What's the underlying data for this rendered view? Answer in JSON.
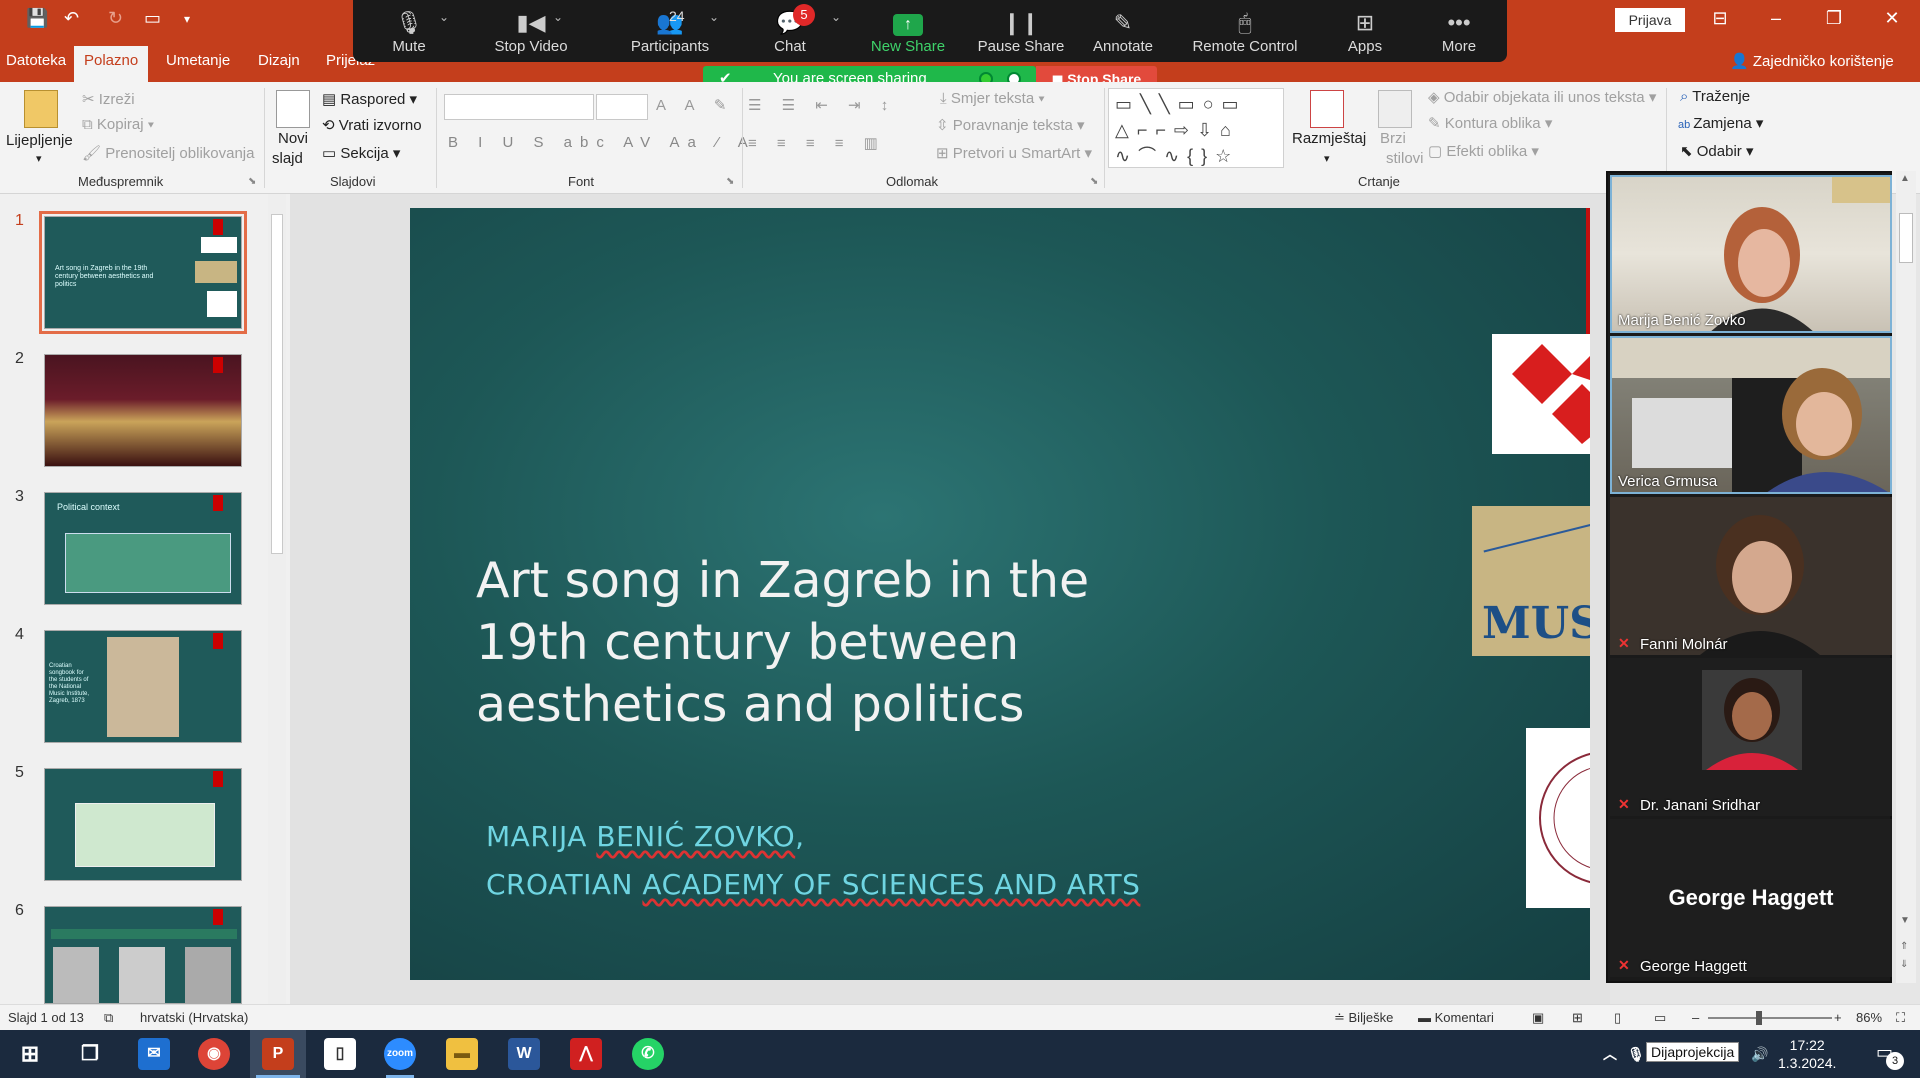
{
  "powerpoint": {
    "signin_label": "Prijava",
    "tabs": [
      "Datoteka",
      "Polazno",
      "Umetanje",
      "Dizajn",
      "Prijelaz"
    ],
    "active_tab": "Polazno",
    "share_label": "Zajedničko korištenje"
  },
  "zoom_toolbar": {
    "buttons": [
      {
        "label": "Mute"
      },
      {
        "label": "Stop Video"
      },
      {
        "label": "Participants"
      },
      {
        "label": "Chat"
      },
      {
        "label": "New Share"
      },
      {
        "label": "Pause Share"
      },
      {
        "label": "Annotate"
      },
      {
        "label": "Remote Control"
      },
      {
        "label": "Apps"
      },
      {
        "label": "More"
      }
    ],
    "participants_count": "24",
    "chat_badge": "5",
    "sharing_banner": "You are screen sharing",
    "stop_share": "Stop Share"
  },
  "ribbon": {
    "clipboard": {
      "label": "Međuspremnik",
      "paste": "Lijepljenje",
      "cut": "Izreži",
      "copy": "Kopiraj",
      "format_painter": "Prenositelj oblikovanja"
    },
    "slides": {
      "label": "Slajdovi",
      "new_slide_1": "Novi",
      "new_slide_2": "slajd",
      "layout": "Raspored",
      "reset": "Vrati izvorno",
      "section": "Sekcija"
    },
    "font": {
      "label": "Font"
    },
    "paragraph": {
      "label": "Odlomak",
      "text_direction": "Smjer teksta",
      "align_text": "Poravnanje teksta",
      "smartart": "Pretvori u SmartArt"
    },
    "drawing": {
      "label": "Crtanje",
      "arrange": "Razmještaj",
      "quick_styles_1": "Brzi",
      "quick_styles_2": "stilovi",
      "select_objects": "Odabir objekata ili unos teksta",
      "shape_outline": "Kontura oblika",
      "shape_effects": "Efekti oblika"
    },
    "editing": {
      "find": "Traženje",
      "replace": "Zamjena",
      "select": "Odabir"
    }
  },
  "slides_panel": {
    "thumbnails": [
      {
        "num": "1",
        "text": "Art song in Zagreb in the 19th century between aesthetics and politics"
      },
      {
        "num": "2",
        "text": ""
      },
      {
        "num": "3",
        "text": "Political context"
      },
      {
        "num": "4",
        "text": "Croatian songbook for the students of the National Music Institute, Zagreb, 1873"
      },
      {
        "num": "5",
        "text": ""
      },
      {
        "num": "6",
        "text": ""
      }
    ]
  },
  "slide": {
    "title": "Art song in Zagreb in the 19th century between aesthetics and politics",
    "author_plain": "MARIJA ",
    "author_underlined": "BENIĆ ZOVKO",
    "author_tail": ",",
    "institution_plain": "CROATIAN ",
    "institution_underlined": "ACADEMY OF SCIENCES AND ARTS"
  },
  "gallery": {
    "participants": [
      {
        "name": "Marija Benić Zovko",
        "muted": false
      },
      {
        "name": "Verica Grmusa",
        "muted": false
      },
      {
        "name": "Fanni Molnár",
        "muted": true
      },
      {
        "name": "Dr. Janani Sridhar",
        "muted": true
      },
      {
        "name": "George Haggett",
        "muted": true,
        "big_name": "George Haggett"
      }
    ]
  },
  "statusbar": {
    "slide_info": "Slajd 1 od 13",
    "language": "hrvatski (Hrvatska)",
    "notes": "Bilješke",
    "comments": "Komentari",
    "zoom": "86%"
  },
  "taskbar": {
    "time": "17:22",
    "date": "1.3.2024.",
    "tooltip": "Dijaprojekcija",
    "notification_count": "3"
  },
  "colors": {
    "ppt_red": "#c43e1c",
    "zoom_green": "#1fb84a",
    "stop_red": "#e24a3c",
    "slide_teal": "#1d5756",
    "slide_sub": "#6fd5e2"
  }
}
